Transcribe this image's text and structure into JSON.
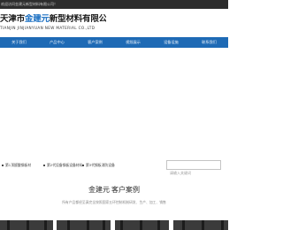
{
  "topbar": {
    "text": "欢迎访问金建元新型材料有限公司！"
  },
  "logo": {
    "name_prefix": "天津市",
    "name_highlight": "金建元",
    "name_suffix": "新型材料有限公司",
    "english": "TIANJIN JINJIANYUAN NEW MATERIAL CO.,LTD"
  },
  "nav": {
    "items": [
      {
        "label": "关于我们"
      },
      {
        "label": "产品中心"
      },
      {
        "label": "客户案例"
      },
      {
        "label": "视频展示"
      },
      {
        "label": "设备设施"
      },
      {
        "label": "联系我们"
      }
    ]
  },
  "hot_tags": [
    "第1顶醛酸钢板材",
    "第2代设备钢板设备材料",
    "第3代钢板消防设备"
  ],
  "search": {
    "placeholder": "请输入关键词"
  },
  "section": {
    "title_main": "金建元",
    "title_sub": "客户案例",
    "description": "所有产品都经至真完全按照国家五环控制机制研发、生产、加工、销售"
  },
  "colors": {
    "nav_bg": "#1e6ab5",
    "brand_highlight": "#1a6fc2",
    "topbar_bg": "#2d2d2d"
  }
}
